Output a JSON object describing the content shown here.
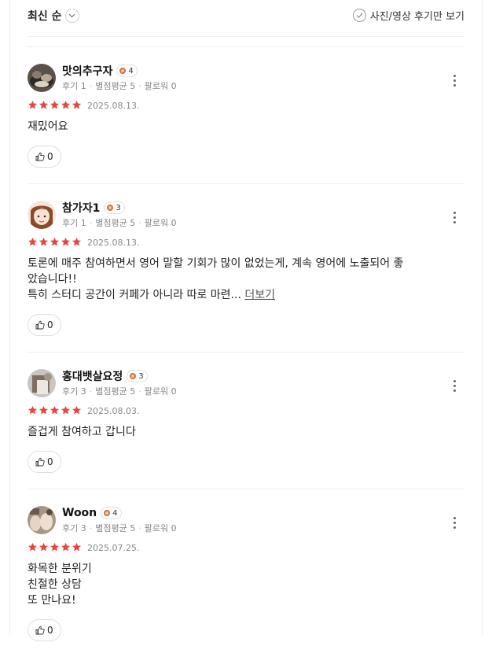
{
  "header": {
    "sort_label": "최신 순",
    "filter_label": "사진/영상 후기만 보기"
  },
  "colors": {
    "star": "#e8453c",
    "badge": "#c8743c"
  },
  "reviews": [
    {
      "name": "맛의추구자",
      "badge": "4",
      "review_count": "후기 1",
      "avg_rating": "별점평균 5",
      "followers": "팔로워 0",
      "stars": 5,
      "date": "2025.08.13.",
      "lines": [
        "재밌어요"
      ],
      "more_label": "",
      "likes": "0"
    },
    {
      "name": "참가자1",
      "badge": "3",
      "review_count": "후기 1",
      "avg_rating": "별점평균 5",
      "followers": "팔로워 0",
      "stars": 5,
      "date": "2025.08.13.",
      "lines": [
        "토론에 매주 참여하면서 영어 말할 기회가 많이 없었는게, 계속 영어에 노출되어 좋",
        "았습니다!!",
        "특히 스터디 공간이 커페가 아니라 따로 마련..."
      ],
      "more_label": "더보기",
      "likes": "0"
    },
    {
      "name": "홍대뱃살요정",
      "badge": "3",
      "review_count": "후기 3",
      "avg_rating": "별점평균 5",
      "followers": "팔로워 0",
      "stars": 5,
      "date": "2025.08.03.",
      "lines": [
        "즐겁게 참여하고 갑니다"
      ],
      "more_label": "",
      "likes": "0"
    },
    {
      "name": "Woon",
      "badge": "4",
      "review_count": "후기 3",
      "avg_rating": "별점평균 5",
      "followers": "팔로워 0",
      "stars": 5,
      "date": "2025.07.25.",
      "lines": [
        "화목한 분위기",
        "친절한 상담",
        "또 만나요!"
      ],
      "more_label": "",
      "likes": "0"
    }
  ]
}
